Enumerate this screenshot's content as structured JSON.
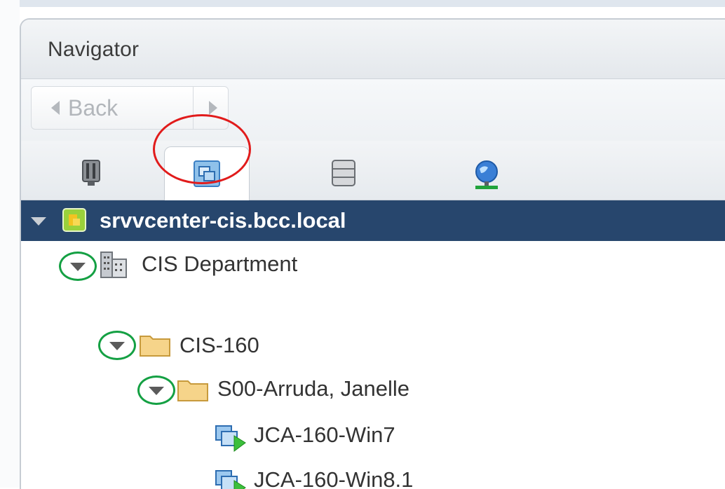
{
  "navigator": {
    "title": "Navigator",
    "back_label": "Back"
  },
  "tabs": [
    {
      "name": "hosts-and-clusters-tab",
      "icon": "hosts-clusters-icon"
    },
    {
      "name": "vms-and-templates-tab",
      "icon": "vms-templates-icon",
      "active": true
    },
    {
      "name": "storage-tab",
      "icon": "storage-icon"
    },
    {
      "name": "networking-tab",
      "icon": "networking-icon"
    }
  ],
  "tree": {
    "vcenter": "srvvcenter-cis.bcc.local",
    "datacenter": "CIS Department",
    "folder": "CIS-160",
    "subfolder": "S00-Arruda, Janelle",
    "vms": [
      "JCA-160-Win7",
      "JCA-160-Win8.1"
    ]
  },
  "colors": {
    "selection": "#27466d",
    "highlight_red": "#e11b1b",
    "highlight_green": "#14a043"
  }
}
